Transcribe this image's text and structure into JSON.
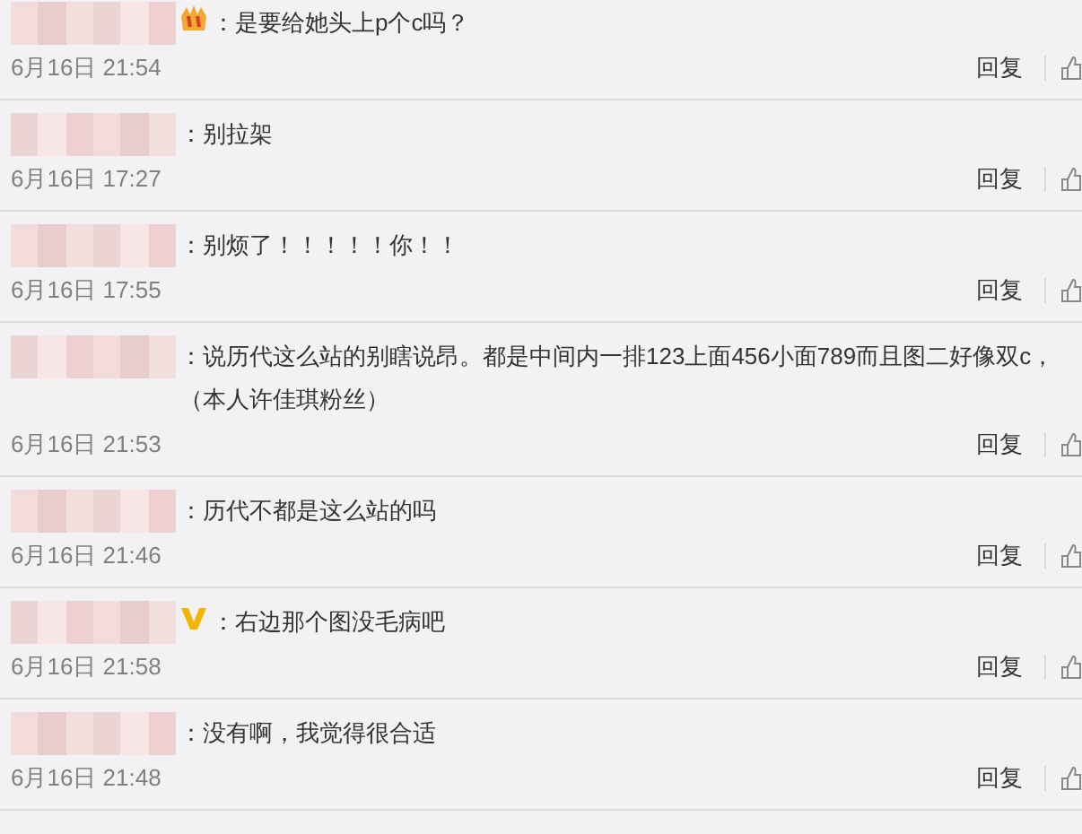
{
  "comments": [
    {
      "vip": true,
      "text": "：是要给她头上p个c吗？",
      "time": "6月16日 21:54",
      "reply": "回复"
    },
    {
      "text": "：别拉架",
      "time": "6月16日 17:27",
      "reply": "回复"
    },
    {
      "text": "：别烦了！！！！！你！！",
      "time": "6月16日 17:55",
      "reply": "回复"
    },
    {
      "text": "：说历代这么站的别瞎说昂。都是中间内一排123上面456小面789而且图二好像双c，（本人许佳琪粉丝）",
      "time": "6月16日 21:53",
      "reply": "回复"
    },
    {
      "text": "：历代不都是这么站的吗",
      "time": "6月16日 21:46",
      "reply": "回复"
    },
    {
      "verified": true,
      "text": "：右边那个图没毛病吧",
      "time": "6月16日 21:58",
      "reply": "回复"
    },
    {
      "text": "：没有啊，我觉得很合适",
      "time": "6月16日 21:48",
      "reply": "回复"
    }
  ]
}
